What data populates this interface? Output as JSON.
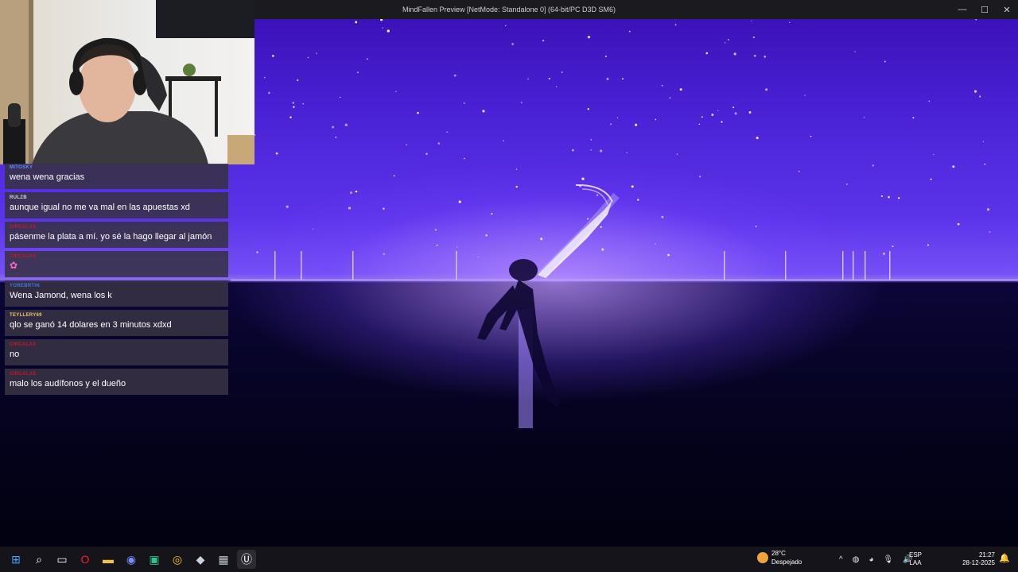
{
  "window": {
    "title": "MindFallen Preview [NetMode: Standalone 0]  (64-bit/PC D3D SM6)",
    "minimize_symbol": "—",
    "maximize_symbol": "☐",
    "close_symbol": "✕"
  },
  "chat": {
    "messages": [
      {
        "user": "MITOSKY",
        "user_color": "#5b8cff",
        "text": "wena wena gracias"
      },
      {
        "user": "RULZB",
        "user_color": "#d8d8d8",
        "text": "aunque igual no me va mal en las apuestas xd"
      },
      {
        "user": "CIRCALAS",
        "user_color": "#c9152a",
        "text": "pásenme la plata a mí. yo sé la hago llegar al jamón"
      },
      {
        "user": "CIRCALAS",
        "user_color": "#c9152a",
        "text": "",
        "emote": "pink-emote"
      },
      {
        "user": "YOREBRTIN",
        "user_color": "#3e7bd6",
        "text": "Wena Jamond, wena los k"
      },
      {
        "user": "TEYLLERY69",
        "user_color": "#e8c46a",
        "text": "qlo se ganó 14 dolares en 3 minutos xdxd"
      },
      {
        "user": "CIRCALAS",
        "user_color": "#c9152a",
        "text": "no"
      },
      {
        "user": "CIRCALAS",
        "user_color": "#c9152a",
        "text": "malo los audífonos y el dueño"
      }
    ]
  },
  "taskbar": {
    "icons": [
      {
        "name": "windows-start-icon",
        "glyph": "⊞",
        "color": "#4aa3ff"
      },
      {
        "name": "search-icon",
        "glyph": "⌕",
        "color": "#ffffff"
      },
      {
        "name": "task-view-icon",
        "glyph": "▭",
        "color": "#ffffff"
      },
      {
        "name": "opera-icon",
        "glyph": "O",
        "color": "#ff1b2d"
      },
      {
        "name": "file-explorer-icon",
        "glyph": "▬",
        "color": "#f3c13a"
      },
      {
        "name": "discord-icon",
        "glyph": "◉",
        "color": "#7c8cf8"
      },
      {
        "name": "app-green-icon",
        "glyph": "▣",
        "color": "#31c48d"
      },
      {
        "name": "chrome-icon",
        "glyph": "◎",
        "color": "#f4c20d"
      },
      {
        "name": "steam-icon",
        "glyph": "◆",
        "color": "#c7d5e0"
      },
      {
        "name": "calculator-icon",
        "glyph": "▦",
        "color": "#bfc4cc"
      },
      {
        "name": "unreal-engine-icon",
        "glyph": "Ⓤ",
        "color": "#ffffff"
      }
    ],
    "weather": {
      "temp": "28°C",
      "condition": "Despejado"
    },
    "tray": [
      "^",
      "◍",
      "◕",
      "🎙",
      "🔊"
    ],
    "language": {
      "line1": "ESP",
      "line2": "LAA"
    },
    "clock": {
      "time": "21:27",
      "date": "28-12-2025"
    },
    "notification_symbol": "🔔"
  }
}
